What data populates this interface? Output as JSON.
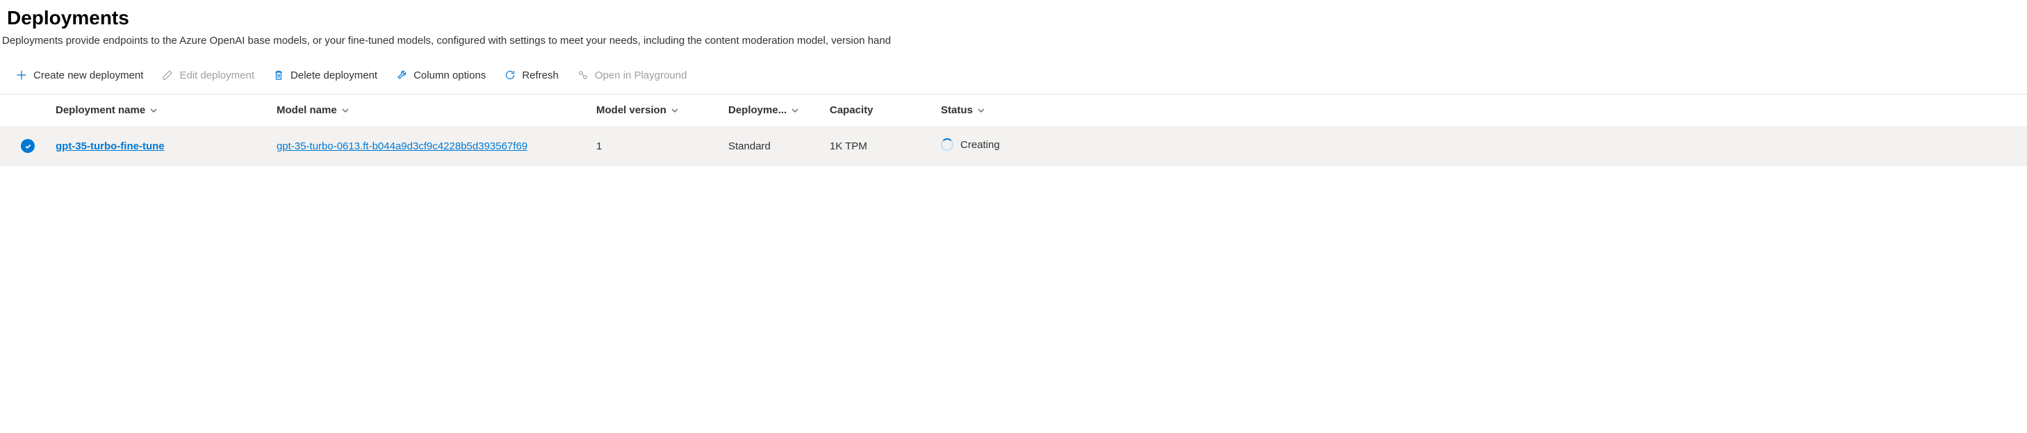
{
  "title": "Deployments",
  "description": "Deployments provide endpoints to the Azure OpenAI base models, or your fine-tuned models, configured with settings to meet your needs, including the content moderation model, version hand",
  "toolbar": {
    "create": "Create new deployment",
    "edit": "Edit deployment",
    "delete": "Delete deployment",
    "columns": "Column options",
    "refresh": "Refresh",
    "playground": "Open in Playground"
  },
  "columns": {
    "deployment_name": "Deployment name",
    "model_name": "Model name",
    "model_version": "Model version",
    "deployment_type": "Deployme...",
    "capacity": "Capacity",
    "status": "Status"
  },
  "rows": [
    {
      "selected": true,
      "deployment_name": "gpt-35-turbo-fine-tune",
      "model_name": "gpt-35-turbo-0613.ft-b044a9d3cf9c4228b5d393567f69",
      "model_version": "1",
      "deployment_type": "Standard",
      "capacity": "1K TPM",
      "status": "Creating"
    }
  ]
}
